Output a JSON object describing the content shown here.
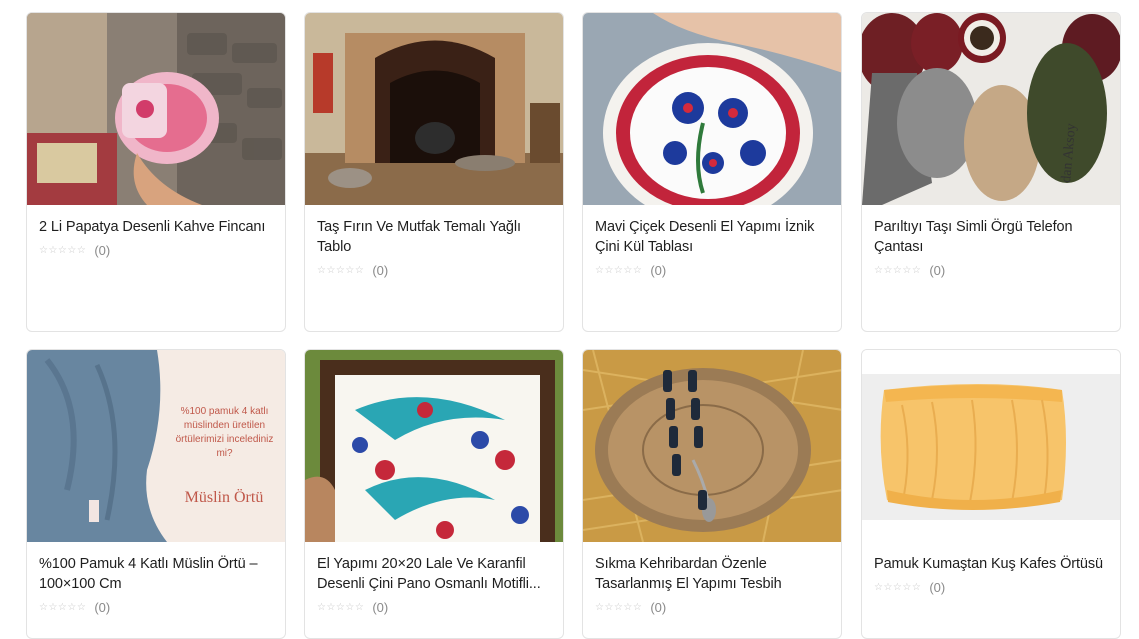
{
  "products": [
    {
      "title": "2 Li Papatya Desenli Kahve Fincanı",
      "rating_count": "(0)",
      "image": "coffee-cup-photo"
    },
    {
      "title": "Taş Fırın Ve Mutfak Temalı Yağlı Tablo",
      "rating_count": "(0)",
      "image": "oil-painting-photo"
    },
    {
      "title": "Mavi Çiçek Desenli El Yapımı İznik Çini Kül Tablası",
      "rating_count": "(0)",
      "image": "ashtray-photo"
    },
    {
      "title": "Parıltıyı Taşı Simli Örgü Telefon Çantası",
      "rating_count": "(0)",
      "image": "knit-phone-bag-photo",
      "image_caption": "dan Aksoy"
    },
    {
      "title": "%100 Pamuk 4 Katlı Müslin Örtü – 100×100 Cm",
      "rating_count": "(0)",
      "image": "muslin-cloth-photo",
      "image_text": "%100 pamuk 4 katlı müslinden üretilen örtülerimizi incelediniz mi?",
      "image_brand": "Müslin Örtü"
    },
    {
      "title": "El Yapımı 20×20 Lale Ve Karanfil Desenli Çini Pano Osmanlı Motifli...",
      "rating_count": "(0)",
      "image": "tile-panel-photo"
    },
    {
      "title": "Sıkma Kehribardan Özenle Tasarlanmış El Yapımı Tesbih",
      "rating_count": "(0)",
      "image": "prayer-beads-photo"
    },
    {
      "title": "Pamuk Kumaştan Kuş Kafes Örtüsü",
      "rating_count": "(0)",
      "image": "bird-cage-cover-photo"
    }
  ],
  "stars": "☆☆☆☆☆"
}
